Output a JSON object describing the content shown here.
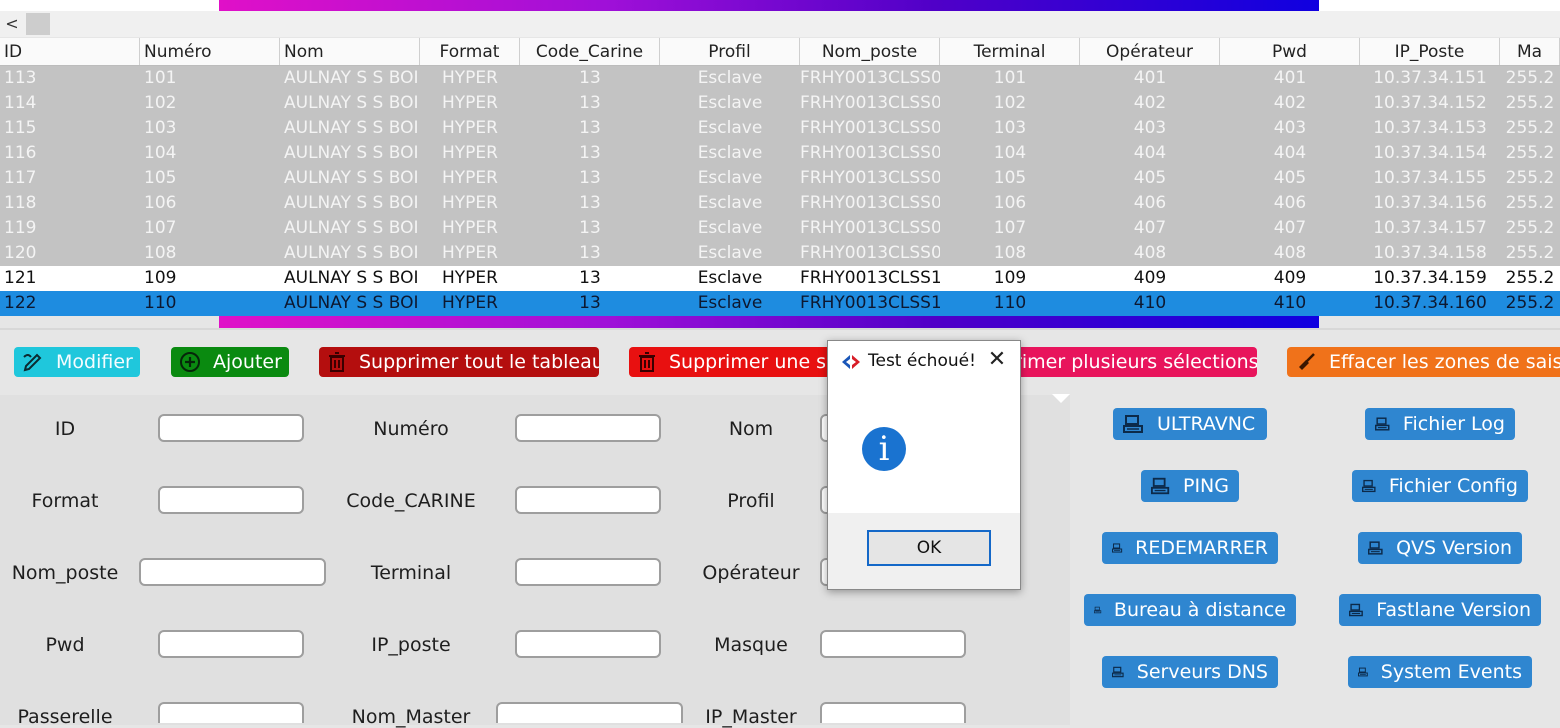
{
  "scroll": {
    "left_arrow": "<"
  },
  "table": {
    "columns": [
      "ID",
      "Numéro",
      "Nom",
      "Format",
      "Code_Carine",
      "Profil",
      "Nom_poste",
      "Terminal",
      "Opérateur",
      "Pwd",
      "IP_Poste",
      "Ma"
    ],
    "rows": [
      [
        "113",
        "101",
        "AULNAY S S BOI",
        "HYPER",
        "13",
        "Esclave",
        "FRHY0013CLSS0",
        "101",
        "401",
        "401",
        "10.37.34.151",
        "255.2"
      ],
      [
        "114",
        "102",
        "AULNAY S S BOI",
        "HYPER",
        "13",
        "Esclave",
        "FRHY0013CLSS0",
        "102",
        "402",
        "402",
        "10.37.34.152",
        "255.2"
      ],
      [
        "115",
        "103",
        "AULNAY S S BOI",
        "HYPER",
        "13",
        "Esclave",
        "FRHY0013CLSS0",
        "103",
        "403",
        "403",
        "10.37.34.153",
        "255.2"
      ],
      [
        "116",
        "104",
        "AULNAY S S BOI",
        "HYPER",
        "13",
        "Esclave",
        "FRHY0013CLSS0",
        "104",
        "404",
        "404",
        "10.37.34.154",
        "255.2"
      ],
      [
        "117",
        "105",
        "AULNAY S S BOI",
        "HYPER",
        "13",
        "Esclave",
        "FRHY0013CLSS0",
        "105",
        "405",
        "405",
        "10.37.34.155",
        "255.2"
      ],
      [
        "118",
        "106",
        "AULNAY S S BOI",
        "HYPER",
        "13",
        "Esclave",
        "FRHY0013CLSS0",
        "106",
        "406",
        "406",
        "10.37.34.156",
        "255.2"
      ],
      [
        "119",
        "107",
        "AULNAY S S BOI",
        "HYPER",
        "13",
        "Esclave",
        "FRHY0013CLSS0",
        "107",
        "407",
        "407",
        "10.37.34.157",
        "255.2"
      ],
      [
        "120",
        "108",
        "AULNAY S S BOI",
        "HYPER",
        "13",
        "Esclave",
        "FRHY0013CLSS0",
        "108",
        "408",
        "408",
        "10.37.34.158",
        "255.2"
      ],
      [
        "121",
        "109",
        "AULNAY S S BOI",
        "HYPER",
        "13",
        "Esclave",
        "FRHY0013CLSS1",
        "109",
        "409",
        "409",
        "10.37.34.159",
        "255.2"
      ],
      [
        "122",
        "110",
        "AULNAY S S BOI",
        "HYPER",
        "13",
        "Esclave",
        "FRHY0013CLSS1",
        "110",
        "410",
        "410",
        "10.37.34.160",
        "255.2"
      ]
    ],
    "row_styles": [
      "grey",
      "grey",
      "grey",
      "grey",
      "grey",
      "grey",
      "grey",
      "grey",
      "white",
      "selected"
    ]
  },
  "toolbar": {
    "modifier": "Modifier",
    "ajouter": "Ajouter",
    "supprimer_tout": "Supprimer tout le tableau",
    "supprimer_une": "Supprimer une sélection",
    "supprimer_plusieurs": "primer plusieurs sélections",
    "effacer": "Effacer les zones de saisie"
  },
  "form": {
    "id": "ID",
    "numero": "Numéro",
    "nom": "Nom",
    "format": "Format",
    "code_carine": "Code_CARINE",
    "profil": "Profil",
    "nom_poste": "Nom_poste",
    "terminal": "Terminal",
    "operateur": "Opérateur",
    "pwd": "Pwd",
    "ip_poste": "IP_poste",
    "masque": "Masque",
    "passerelle": "Passerelle",
    "nom_master": "Nom_Master",
    "ip_master": "IP_Master"
  },
  "actions": {
    "ultravnc": "ULTRAVNC",
    "fichier_log": "Fichier Log",
    "ping": "PING",
    "fichier_config": "Fichier Config",
    "redemarrer": "REDEMARRER",
    "qvs_version": "QVS Version",
    "bureau": "Bureau à distance",
    "fastlane": "Fastlane Version",
    "dns": "Serveurs DNS",
    "system_events": "System Events"
  },
  "dialog": {
    "title": "Test échoué!",
    "close": "✕",
    "info_glyph": "i",
    "ok": "OK"
  },
  "colors": {
    "selected_row": "#1e8ce0",
    "button_action": "#2f86d0",
    "dialog_ok_border": "#1468c8"
  }
}
